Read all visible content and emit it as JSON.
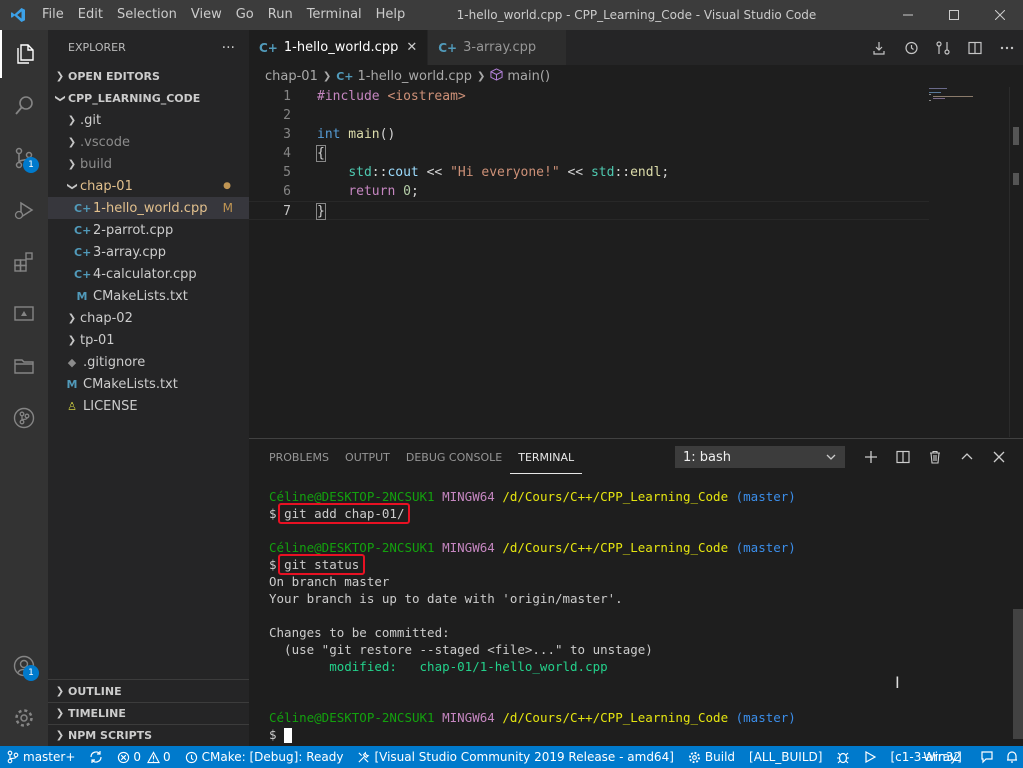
{
  "window": {
    "title": "1-hello_world.cpp - CPP_Learning_Code - Visual Studio Code",
    "menu": [
      "File",
      "Edit",
      "Selection",
      "View",
      "Go",
      "Run",
      "Terminal",
      "Help"
    ]
  },
  "activity": {
    "scm_badge": "1",
    "accounts_badge": "1"
  },
  "explorer": {
    "header": "EXPLORER",
    "more": "···",
    "open_editors": "OPEN EDITORS",
    "root": "CPP_LEARNING_CODE",
    "items": [
      {
        "label": ".git"
      },
      {
        "label": ".vscode"
      },
      {
        "label": "build"
      },
      {
        "label": "chap-01"
      },
      {
        "label": "1-hello_world.cpp",
        "status": "M"
      },
      {
        "label": "2-parrot.cpp"
      },
      {
        "label": "3-array.cpp"
      },
      {
        "label": "4-calculator.cpp"
      },
      {
        "label": "CMakeLists.txt"
      },
      {
        "label": "chap-02"
      },
      {
        "label": "tp-01"
      },
      {
        "label": ".gitignore"
      },
      {
        "label": "CMakeLists.txt"
      },
      {
        "label": "LICENSE"
      }
    ],
    "outline": "OUTLINE",
    "timeline": "TIMELINE",
    "npm": "NPM SCRIPTS",
    "modified_dot": "●"
  },
  "tabs": [
    {
      "label": "1-hello_world.cpp",
      "close": "✕"
    },
    {
      "label": "3-array.cpp"
    }
  ],
  "breadcrumb": {
    "folder": "chap-01",
    "file": "1-hello_world.cpp",
    "symbol": "main()"
  },
  "code": {
    "line_numbers": [
      "1",
      "2",
      "3",
      "4",
      "5",
      "6",
      "7"
    ],
    "l1_pp": "#include",
    "l1_inc": " <iostream>",
    "l3_kw": "int",
    "l3_fn": " main",
    "l3_rest": "()",
    "l4": "{",
    "l5_ns1": "std",
    "l5_sep1": "::",
    "l5_var": "cout",
    "l5_op1": " << ",
    "l5_str": "\"Hi everyone!\"",
    "l5_op2": " << ",
    "l5_ns2": "std",
    "l5_sep2": "::",
    "l5_fn": "endl",
    "l5_end": ";",
    "l6_kw": "return",
    "l6_num": " 0",
    "l6_end": ";",
    "l7": "}"
  },
  "panel": {
    "tabs": [
      "PROBLEMS",
      "OUTPUT",
      "DEBUG CONSOLE",
      "TERMINAL"
    ],
    "terminal_select": "1: bash"
  },
  "terminal": {
    "user": "Céline@DESKTOP-2NCSUK1",
    "host": " MINGW64",
    "path": " /d/Cours/C++/CPP_Learning_Code",
    "branch": " (master)",
    "prompt": "$",
    "cmd1": "git add chap-01/",
    "cmd2": "git status",
    "out1": "On branch master",
    "out2": "Your branch is up to date with 'origin/master'.",
    "out3": "Changes to be committed:",
    "out4": "  (use \"git restore --staged <file>...\" to unstage)",
    "out5_label": "        modified:   ",
    "out5_file": "chap-01/1-hello_world.cpp"
  },
  "statusbar": {
    "branch": "master+",
    "errors": "0",
    "warnings": "0",
    "cmake": "CMake: [Debug]: Ready",
    "kit": "[Visual Studio Community 2019 Release - amd64]",
    "build": "Build",
    "target": "[ALL_BUILD]",
    "launch_target": "[c1-3-array]",
    "platform": "Win32"
  },
  "colors": {
    "accent": "#007acc",
    "highlight_box": "#e81123"
  }
}
